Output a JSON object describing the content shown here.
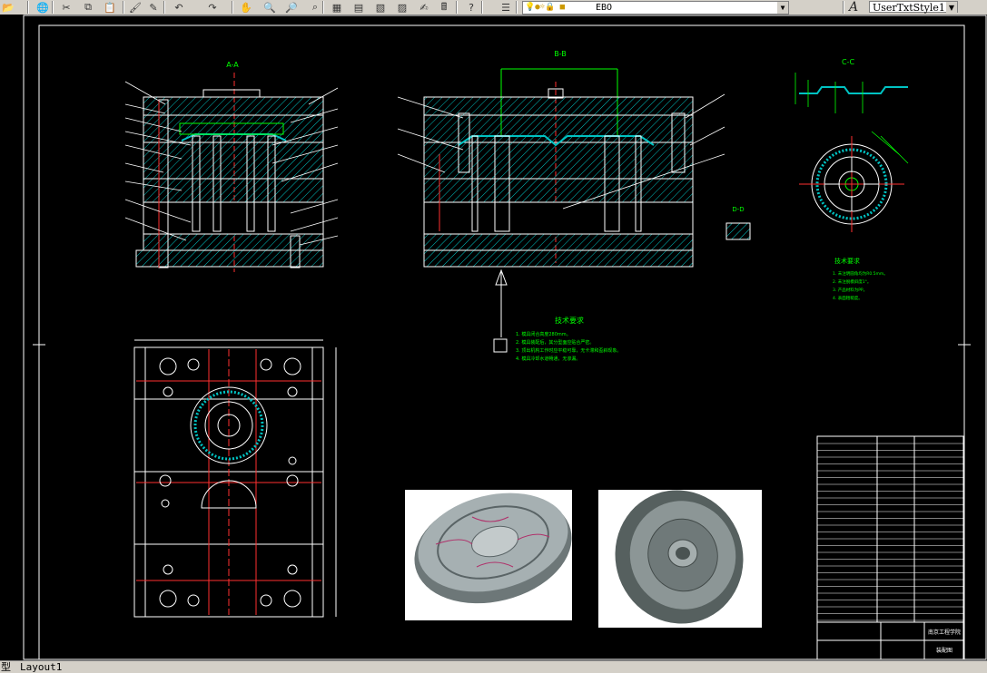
{
  "toolbar": {
    "buttons": [
      "open-icon",
      "publish-icon",
      "cut-icon",
      "copy-icon",
      "paste-icon",
      "match-properties-icon",
      "brush-icon",
      "undo-icon",
      "redo-icon",
      "pan-icon",
      "zoom-realtime-icon",
      "zoom-window-icon",
      "zoom-previous-icon",
      "properties-icon",
      "design-center-icon",
      "tool-palettes-icon",
      "sheet-set-icon",
      "markup-icon",
      "calculator-icon",
      "help-icon",
      "layer-manager-icon"
    ],
    "layer_name": "EBO",
    "text_style": "UserTxtStyle1",
    "text_style_icon": "text-style-icon"
  },
  "drawing": {
    "section_aa": "A-A",
    "section_bb": "B-B",
    "section_cc": "C-C",
    "detail_d": "D-D",
    "tech_req_title": "技术要求",
    "tech_notes_main": [
      "1. 模具闭合高度280mm。",
      "2. 模具装配后，其分型面应贴合严密。",
      "3. 顶出机构工作时应平稳可靠，无卡滞和歪斜现象。",
      "4. 模具冷却水道畅通，无渗漏。"
    ],
    "tech_notes_right": [
      "1. 未注明圆角均为R0.5mm。",
      "2. 未注脱模斜度1°。",
      "3. 产品材料为PP。",
      "4. 表面粗糙度。"
    ],
    "title_block_school": "南京工程学院",
    "title_block_drawing": "装配图"
  },
  "colors": {
    "background": "#000000",
    "line": "#ffffff",
    "hatch": "#00c2c2",
    "green": "#00ff00",
    "red": "#ff3030"
  },
  "tabs": {
    "model": "型",
    "layout1": "Layout1"
  }
}
